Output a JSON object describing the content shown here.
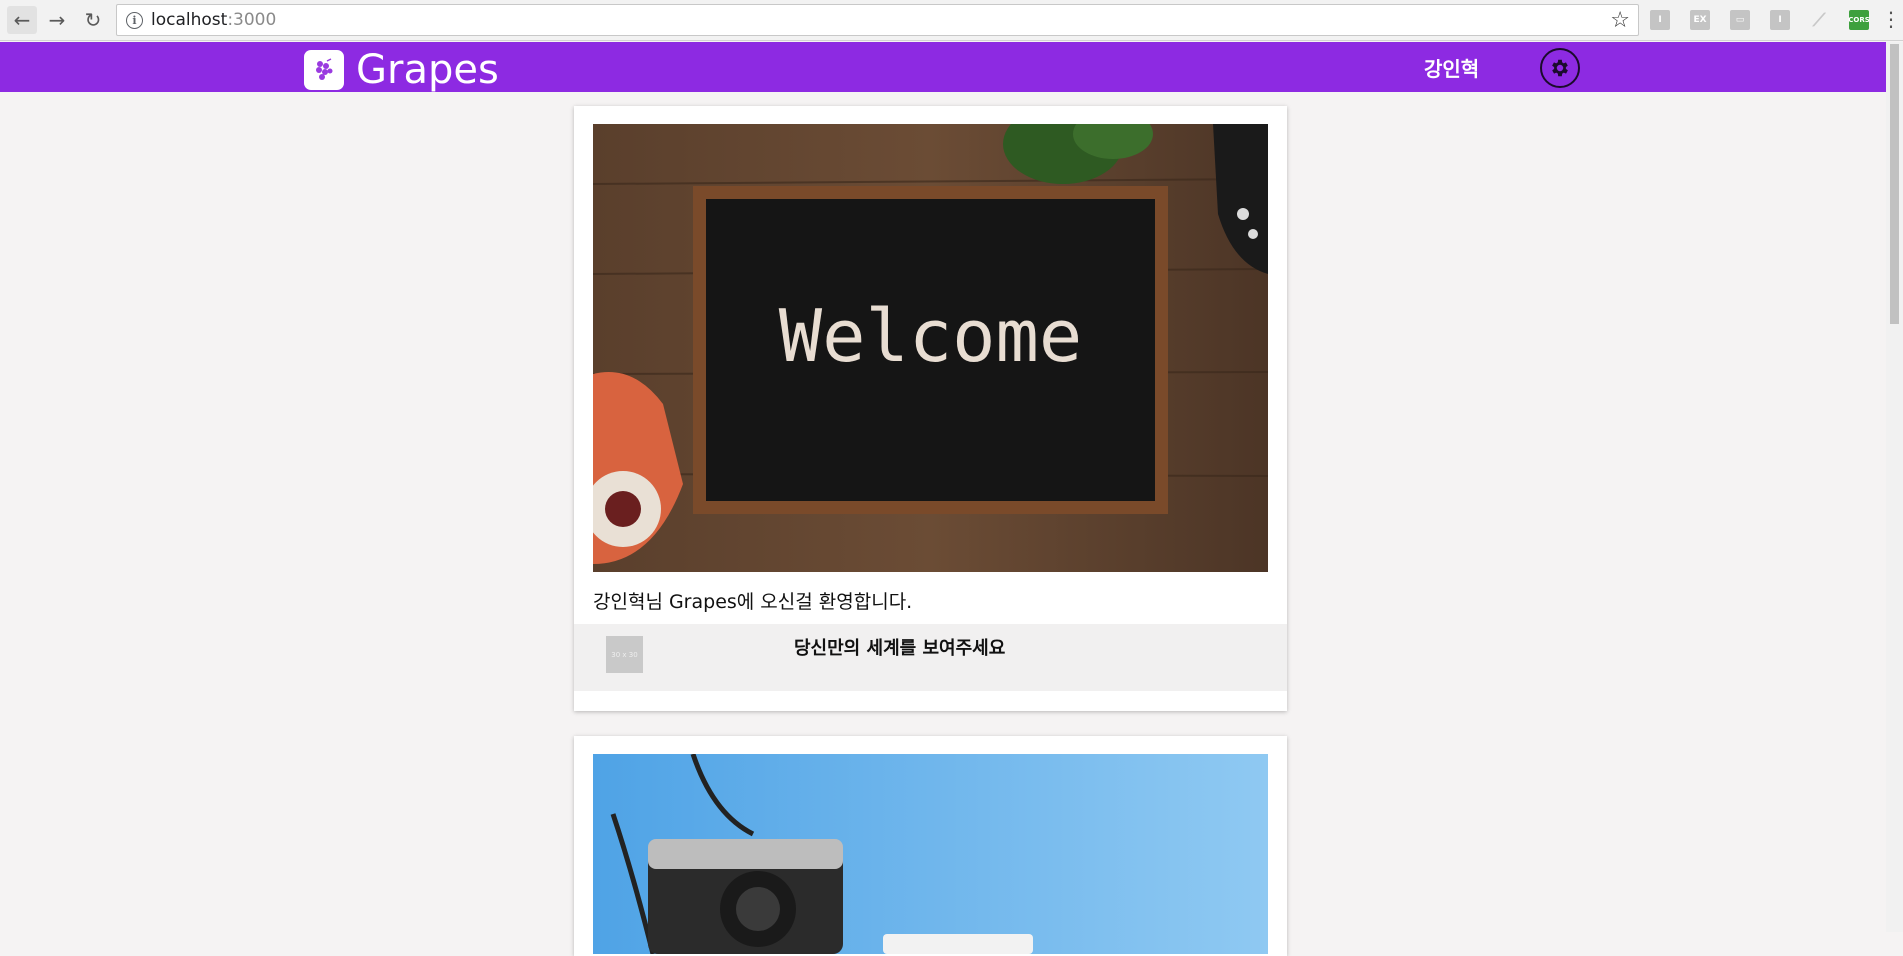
{
  "browser": {
    "url_host": "localhost",
    "url_port": ":3000",
    "extensions": [
      "I",
      "EX",
      "▭",
      "I",
      "⟋",
      "CORS"
    ]
  },
  "header": {
    "brand": "Grapes",
    "username": "강인혁",
    "accent_color": "#8d2ae2"
  },
  "feed": {
    "cards": [
      {
        "image_text": "Welcome",
        "caption": "강인혁님 Grapes에 오신걸 환영합니다.",
        "thumb_label": "30 x 30",
        "footer_text": "당신만의 세계를 보여주세요"
      },
      {
        "image_subject": "camera-photo"
      }
    ]
  }
}
